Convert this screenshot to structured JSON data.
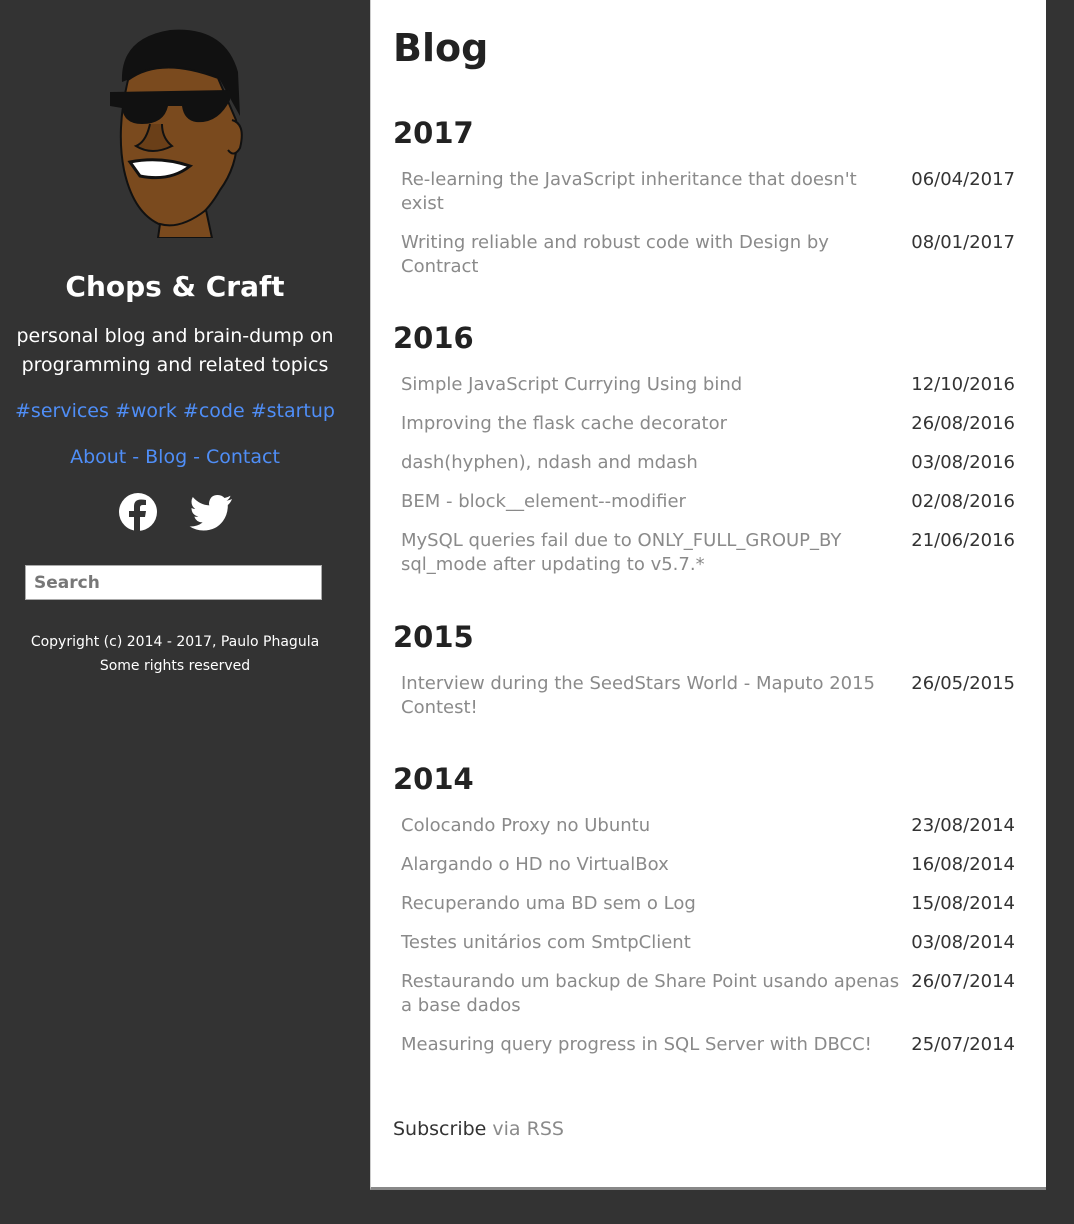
{
  "sidebar": {
    "title": "Chops & Craft",
    "tagline": "personal blog and brain-dump on programming and related topics",
    "tags": [
      "#services",
      "#work",
      "#code",
      "#startup"
    ],
    "nav": {
      "about": "About",
      "blog": "Blog",
      "contact": "Contact",
      "separator": "-"
    },
    "social": [
      "facebook-icon",
      "twitter-icon"
    ],
    "search_placeholder": "Search",
    "copyright_line1": "Copyright (c) 2014 - 2017, Paulo Phagula",
    "copyright_line2": "Some rights reserved"
  },
  "main": {
    "page_title": "Blog",
    "years": [
      {
        "year": "2017",
        "posts": [
          {
            "title": "Re-learning the JavaScript inheritance that doesn't exist",
            "date": "06/04/2017"
          },
          {
            "title": "Writing reliable and robust code with Design by Contract",
            "date": "08/01/2017"
          }
        ]
      },
      {
        "year": "2016",
        "posts": [
          {
            "title": "Simple JavaScript Currying Using bind",
            "date": "12/10/2016"
          },
          {
            "title": "Improving the flask cache decorator",
            "date": "26/08/2016"
          },
          {
            "title": "dash(hyphen), ndash and mdash",
            "date": "03/08/2016"
          },
          {
            "title": "BEM - block__element--modifier",
            "date": "02/08/2016"
          },
          {
            "title": "MySQL queries fail due to ONLY_FULL_GROUP_BY sql_mode after updating to v5.7.*",
            "date": "21/06/2016"
          }
        ]
      },
      {
        "year": "2015",
        "posts": [
          {
            "title": "Interview during the SeedStars World - Maputo 2015 Contest!",
            "date": "26/05/2015"
          }
        ]
      },
      {
        "year": "2014",
        "posts": [
          {
            "title": "Colocando Proxy no Ubuntu",
            "date": "23/08/2014"
          },
          {
            "title": "Alargando o HD no VirtualBox",
            "date": "16/08/2014"
          },
          {
            "title": "Recuperando uma BD sem o Log",
            "date": "15/08/2014"
          },
          {
            "title": "Testes unitários com SmtpClient",
            "date": "03/08/2014"
          },
          {
            "title": "Restaurando um backup de Share Point usando apenas a base dados",
            "date": "26/07/2014"
          },
          {
            "title": "Measuring query progress in SQL Server with DBCC!",
            "date": "25/07/2014"
          }
        ]
      }
    ],
    "subscribe_text": "Subscribe",
    "subscribe_link": "via RSS"
  },
  "colors": {
    "sidebar_bg": "#333333",
    "link_blue": "#4f8ef7",
    "post_title_gray": "#8a8a8a"
  }
}
